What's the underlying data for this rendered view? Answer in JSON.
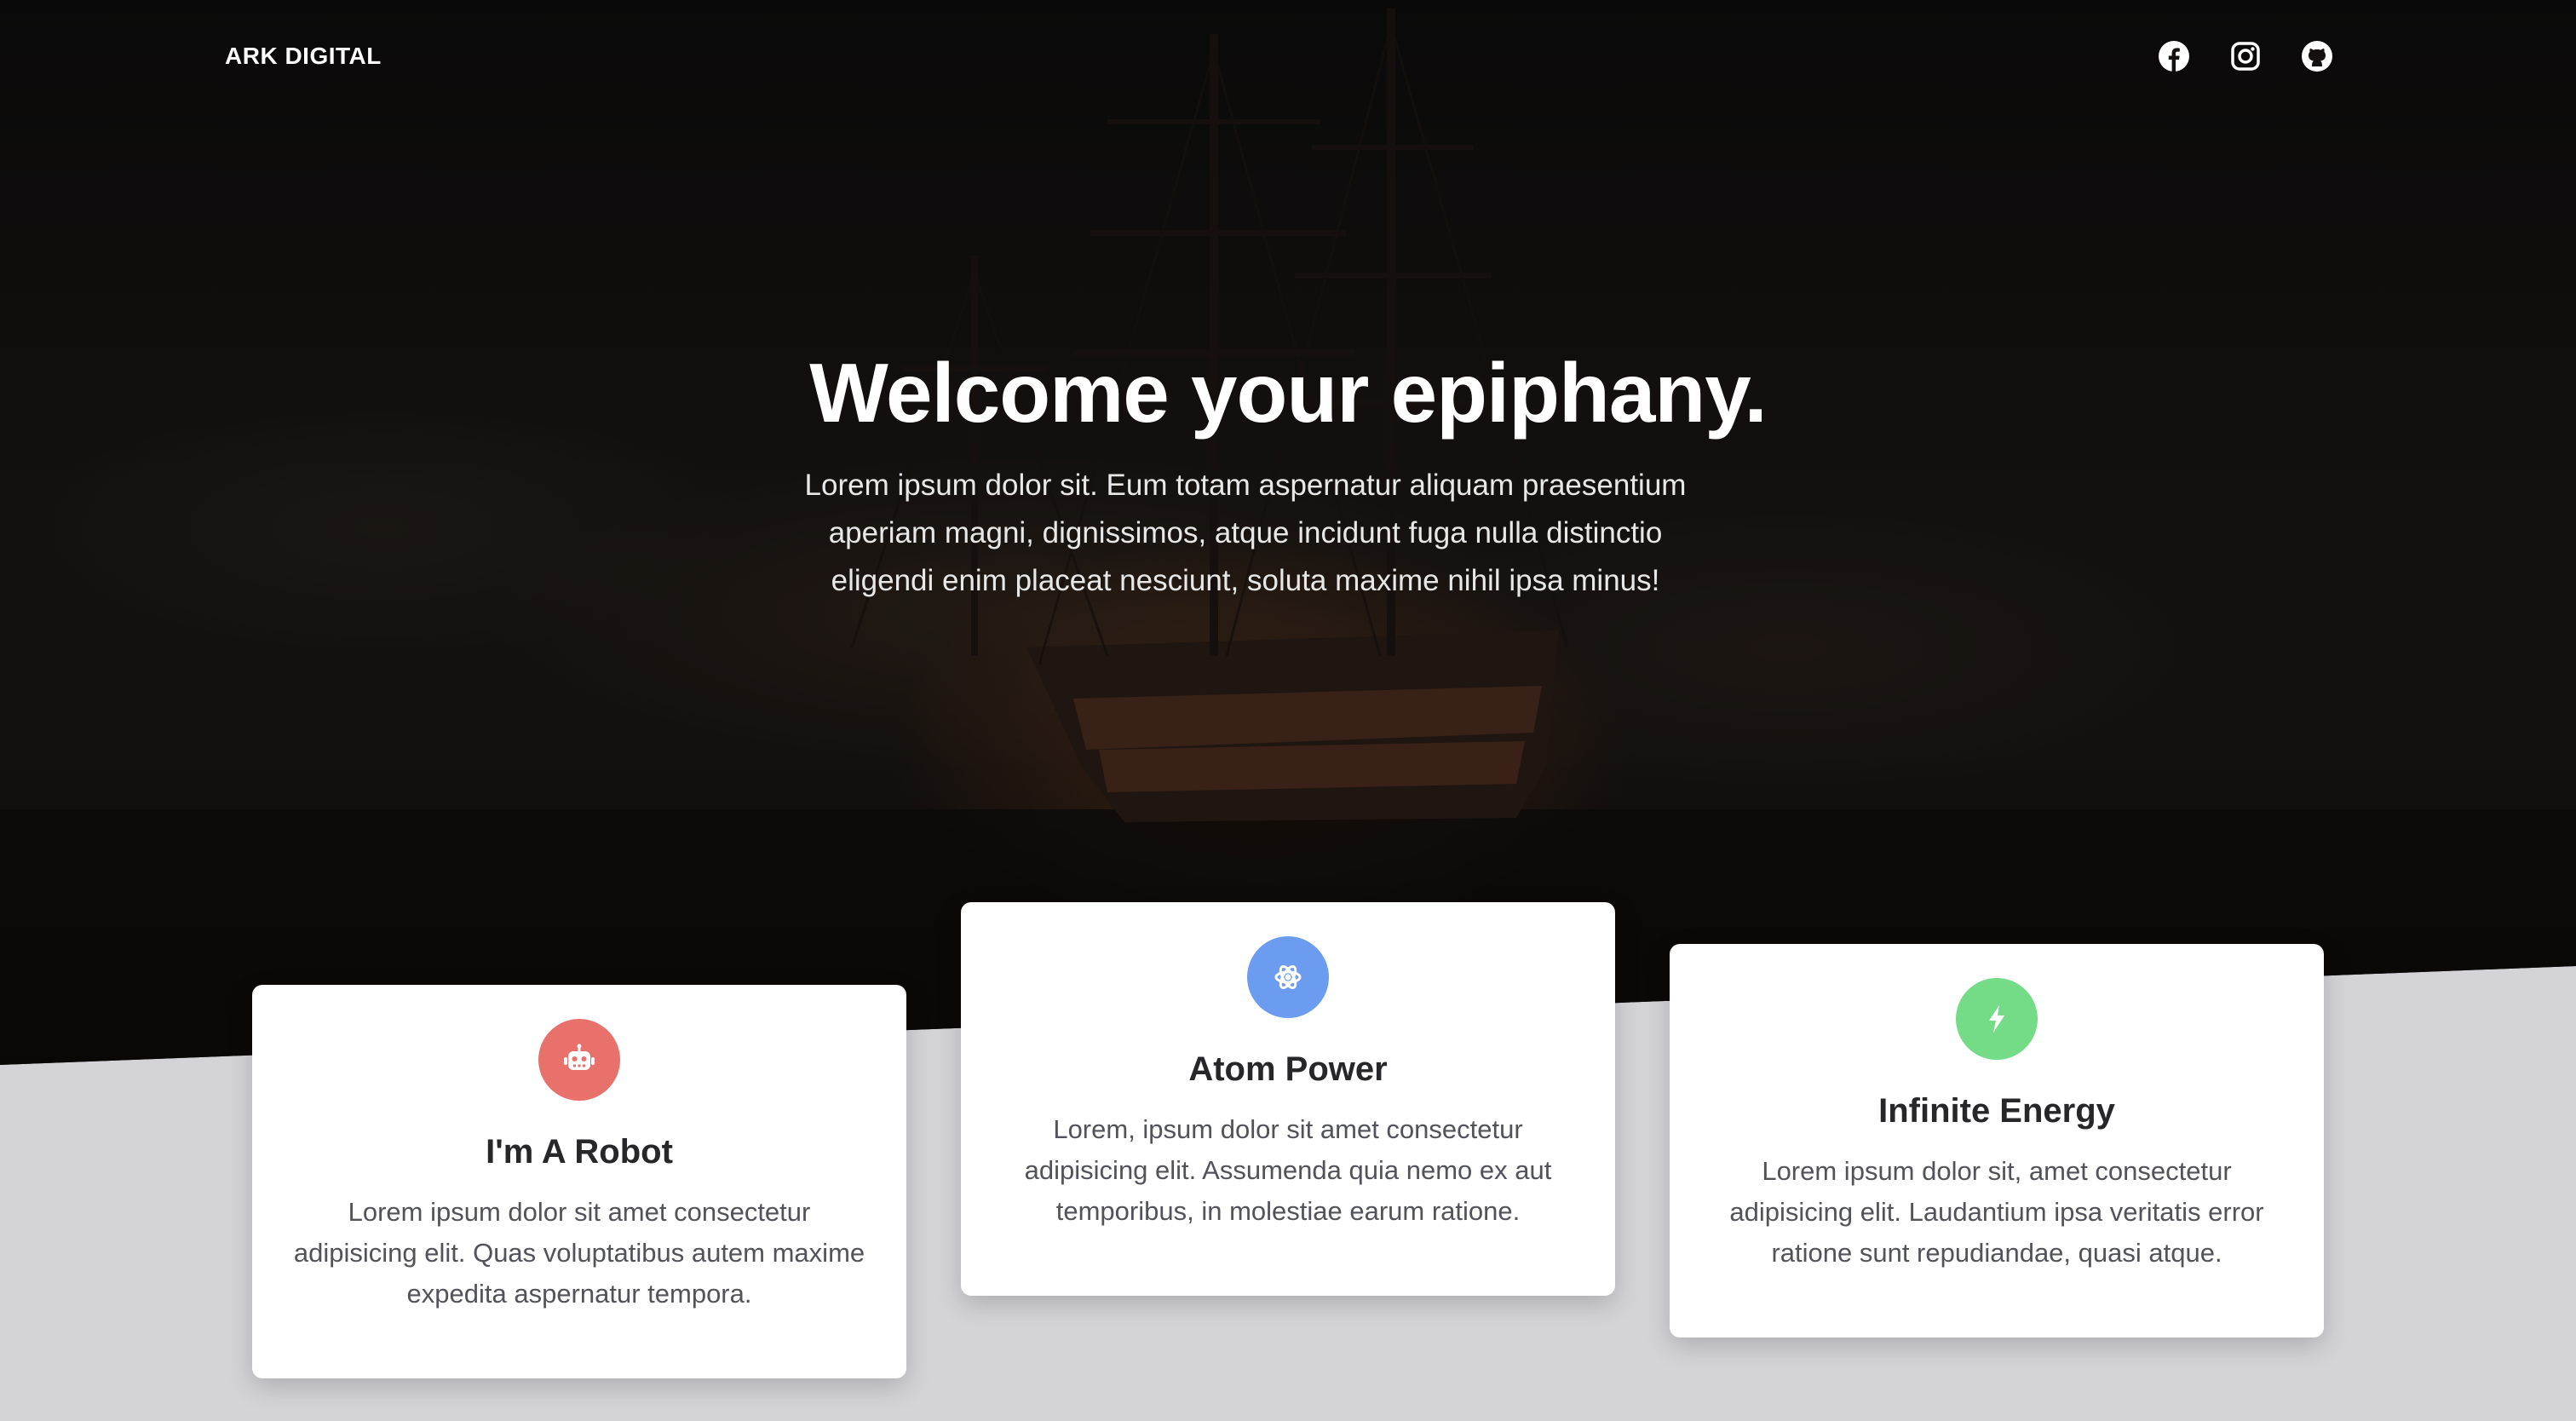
{
  "nav": {
    "brand": "ARK DIGITAL",
    "social_icons": [
      "facebook-icon",
      "instagram-icon",
      "github-icon"
    ]
  },
  "hero": {
    "title": "Welcome your epiphany.",
    "text": "Lorem ipsum dolor sit. Eum totam aspernatur aliquam praesentium aperiam magni, dignissimos, atque incidunt fuga nulla distinctio eligendi enim placeat nesciunt, soluta maxime nihil ipsa minus!"
  },
  "cards": [
    {
      "icon": "robot-icon",
      "icon_color": "#e8716b",
      "title": "I'm A Robot",
      "text": "Lorem ipsum dolor sit amet consectetur adipisicing elit. Quas voluptatibus autem maxime expedita aspernatur tempora."
    },
    {
      "icon": "atom-icon",
      "icon_color": "#6b9cf0",
      "title": "Atom Power",
      "text": "Lorem, ipsum dolor sit amet consectetur adipisicing elit. Assumenda quia nemo ex aut temporibus, in molestiae earum ratione."
    },
    {
      "icon": "bolt-icon",
      "icon_color": "#74dc86",
      "title": "Infinite Energy",
      "text": "Lorem ipsum dolor sit, amet consectetur adipisicing elit. Laudantium ipsa veritatis error ratione sunt repudiandae, quasi atque."
    }
  ],
  "colors": {
    "page_background": "#d4d4d8",
    "card_background": "#ffffff",
    "hero_text": "#ffffff"
  }
}
